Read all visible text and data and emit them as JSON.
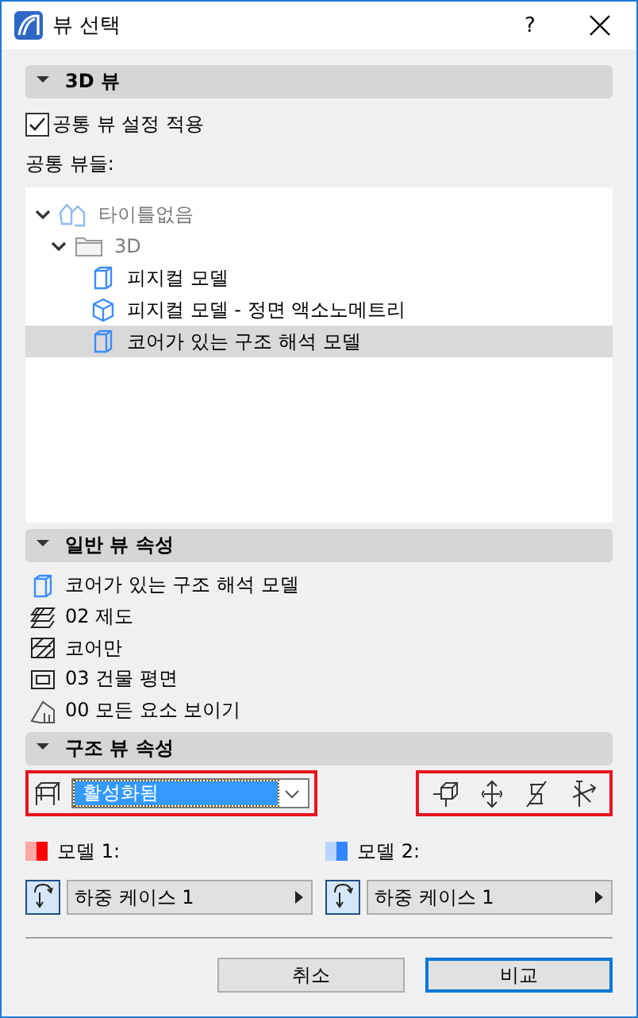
{
  "window": {
    "title": "뷰 선택",
    "help": "?"
  },
  "view3d": {
    "header": {
      "label": "3D 뷰",
      "expanded": true
    },
    "common_settings": {
      "label": "공통 뷰 설정 적용",
      "checked": true
    },
    "list_label": "공통 뷰들:",
    "tree": [
      {
        "label": "타이틀없음",
        "kind": "project",
        "expanded": true,
        "selected": false,
        "children": [
          {
            "label": "3D",
            "kind": "folder",
            "expanded": true,
            "selected": false,
            "children": [
              {
                "label": "피지컬 모델",
                "kind": "view",
                "selected": false
              },
              {
                "label": "피지컬 모델 - 정면 액소노메트리",
                "kind": "axo",
                "selected": false
              },
              {
                "label": "코어가 있는 구조 해석 모델",
                "kind": "view",
                "selected": true
              }
            ]
          }
        ]
      }
    ]
  },
  "general": {
    "header": {
      "label": "일반 뷰 속성",
      "expanded": true
    },
    "properties": [
      {
        "kind": "view",
        "text": "코어가 있는 구조 해석 모델"
      },
      {
        "kind": "layers",
        "text": "02 제도"
      },
      {
        "kind": "hatch",
        "text": "코어만"
      },
      {
        "kind": "plan",
        "text": "03 건물 평면"
      },
      {
        "kind": "model",
        "text": "00 모든 요소 보이기"
      }
    ]
  },
  "structural": {
    "header": {
      "label": "구조 뷰 속성",
      "expanded": true
    },
    "mode": {
      "value": "활성화됨"
    }
  },
  "models": [
    {
      "label": "모델 1:",
      "color": "#ff0000",
      "load_case": "하중 케이스 1"
    },
    {
      "label": "모델 2:",
      "color": "#3385ff",
      "load_case": "하중 케이스 1"
    }
  ],
  "buttons": [
    {
      "label": "취소",
      "kind": "cancel"
    },
    {
      "label": "비교",
      "kind": "default"
    }
  ]
}
